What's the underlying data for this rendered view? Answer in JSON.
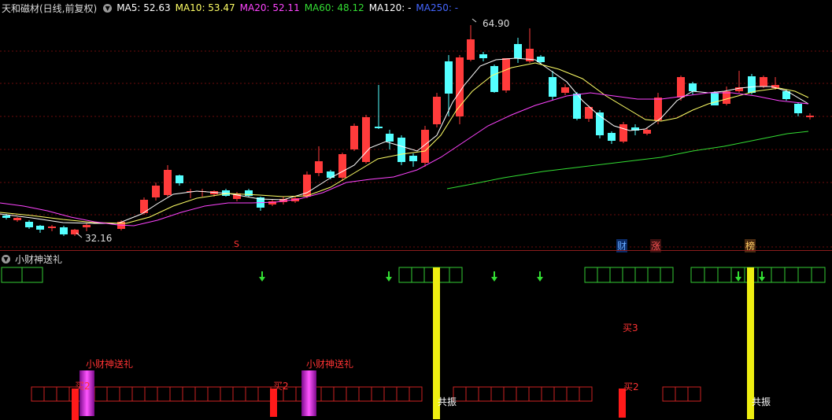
{
  "main": {
    "title": "天和磁材(日线,前复权)",
    "ma": [
      {
        "label": "MA5: 52.63",
        "color": "#ffffff"
      },
      {
        "label": "MA10: 53.47",
        "color": "#ffff66"
      },
      {
        "label": "MA20: 52.11",
        "color": "#ff44ff"
      },
      {
        "label": "MA60: 48.12",
        "color": "#33dd33"
      },
      {
        "label": "MA120: -",
        "color": "#ffffff"
      },
      {
        "label": "MA250: -",
        "color": "#4466ff"
      }
    ],
    "high_label": "64.90",
    "low_label": "32.16",
    "markers": [
      {
        "text": "S",
        "color": "#ff3333"
      },
      {
        "text": "财",
        "color": "#66aaff"
      },
      {
        "text": "涨",
        "color": "#ff5555"
      },
      {
        "text": "榜",
        "color": "#ffcc66"
      }
    ],
    "colors": {
      "up": "#ff3b3b",
      "down": "#54ffff",
      "grid": "#6b0d0d"
    }
  },
  "indicator": {
    "title": "小财神送礼",
    "labels": [
      {
        "text": "小财神送礼",
        "color": "#ff3333"
      },
      {
        "text": "买2",
        "color": "#ff3333"
      },
      {
        "text": "小财神送礼",
        "color": "#ff3333"
      },
      {
        "text": "买2",
        "color": "#ff3333"
      },
      {
        "text": "共振",
        "color": "#ffffff"
      },
      {
        "text": "买3",
        "color": "#ff3333"
      },
      {
        "text": "买2",
        "color": "#ff3333"
      },
      {
        "text": "共振",
        "color": "#ffffff"
      }
    ]
  }
}
